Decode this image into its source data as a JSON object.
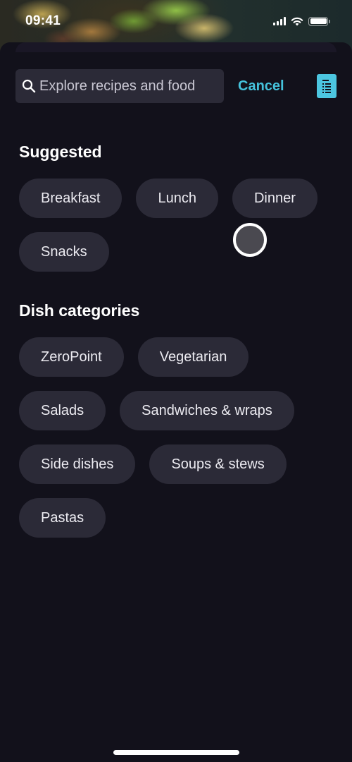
{
  "status_bar": {
    "time": "09:41",
    "icons": [
      "cellular-signal-icon",
      "wifi-icon",
      "battery-icon"
    ]
  },
  "search": {
    "placeholder": "Explore recipes and food",
    "value": "",
    "cancel_label": "Cancel",
    "list_icon": "list-document-icon"
  },
  "colors": {
    "background": "#12111b",
    "chip": "#2b2a37",
    "accent": "#45c2dc"
  },
  "suggested": {
    "title": "Suggested",
    "chips": [
      "Breakfast",
      "Lunch",
      "Dinner",
      "Snacks"
    ]
  },
  "dish_categories": {
    "title": "Dish categories",
    "chips": [
      "ZeroPoint",
      "Vegetarian",
      "Salads",
      "Sandwiches & wraps",
      "Side dishes",
      "Soups & stews",
      "Pastas"
    ]
  }
}
